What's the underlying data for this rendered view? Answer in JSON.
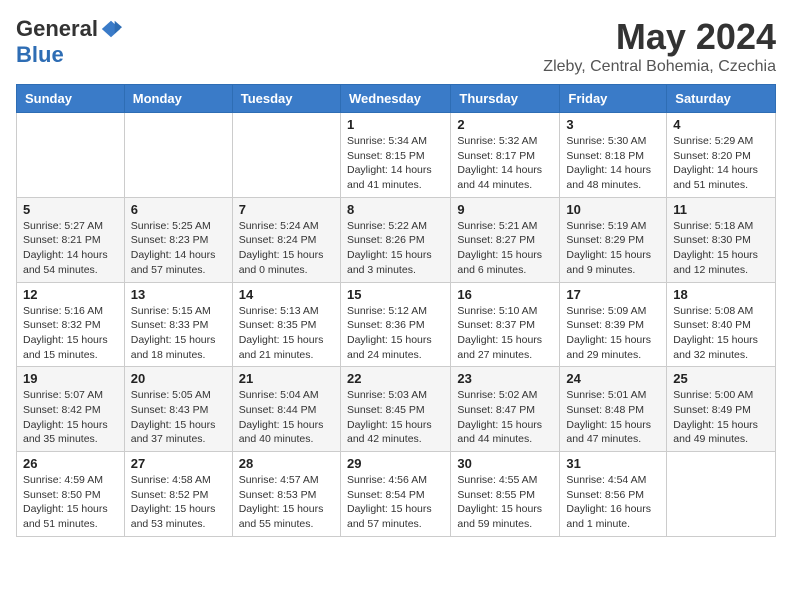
{
  "logo": {
    "general": "General",
    "blue": "Blue"
  },
  "title": "May 2024",
  "subtitle": "Zleby, Central Bohemia, Czechia",
  "days_of_week": [
    "Sunday",
    "Monday",
    "Tuesday",
    "Wednesday",
    "Thursday",
    "Friday",
    "Saturday"
  ],
  "weeks": [
    [
      {
        "day": "",
        "info": ""
      },
      {
        "day": "",
        "info": ""
      },
      {
        "day": "",
        "info": ""
      },
      {
        "day": "1",
        "info": "Sunrise: 5:34 AM\nSunset: 8:15 PM\nDaylight: 14 hours and 41 minutes."
      },
      {
        "day": "2",
        "info": "Sunrise: 5:32 AM\nSunset: 8:17 PM\nDaylight: 14 hours and 44 minutes."
      },
      {
        "day": "3",
        "info": "Sunrise: 5:30 AM\nSunset: 8:18 PM\nDaylight: 14 hours and 48 minutes."
      },
      {
        "day": "4",
        "info": "Sunrise: 5:29 AM\nSunset: 8:20 PM\nDaylight: 14 hours and 51 minutes."
      }
    ],
    [
      {
        "day": "5",
        "info": "Sunrise: 5:27 AM\nSunset: 8:21 PM\nDaylight: 14 hours and 54 minutes."
      },
      {
        "day": "6",
        "info": "Sunrise: 5:25 AM\nSunset: 8:23 PM\nDaylight: 14 hours and 57 minutes."
      },
      {
        "day": "7",
        "info": "Sunrise: 5:24 AM\nSunset: 8:24 PM\nDaylight: 15 hours and 0 minutes."
      },
      {
        "day": "8",
        "info": "Sunrise: 5:22 AM\nSunset: 8:26 PM\nDaylight: 15 hours and 3 minutes."
      },
      {
        "day": "9",
        "info": "Sunrise: 5:21 AM\nSunset: 8:27 PM\nDaylight: 15 hours and 6 minutes."
      },
      {
        "day": "10",
        "info": "Sunrise: 5:19 AM\nSunset: 8:29 PM\nDaylight: 15 hours and 9 minutes."
      },
      {
        "day": "11",
        "info": "Sunrise: 5:18 AM\nSunset: 8:30 PM\nDaylight: 15 hours and 12 minutes."
      }
    ],
    [
      {
        "day": "12",
        "info": "Sunrise: 5:16 AM\nSunset: 8:32 PM\nDaylight: 15 hours and 15 minutes."
      },
      {
        "day": "13",
        "info": "Sunrise: 5:15 AM\nSunset: 8:33 PM\nDaylight: 15 hours and 18 minutes."
      },
      {
        "day": "14",
        "info": "Sunrise: 5:13 AM\nSunset: 8:35 PM\nDaylight: 15 hours and 21 minutes."
      },
      {
        "day": "15",
        "info": "Sunrise: 5:12 AM\nSunset: 8:36 PM\nDaylight: 15 hours and 24 minutes."
      },
      {
        "day": "16",
        "info": "Sunrise: 5:10 AM\nSunset: 8:37 PM\nDaylight: 15 hours and 27 minutes."
      },
      {
        "day": "17",
        "info": "Sunrise: 5:09 AM\nSunset: 8:39 PM\nDaylight: 15 hours and 29 minutes."
      },
      {
        "day": "18",
        "info": "Sunrise: 5:08 AM\nSunset: 8:40 PM\nDaylight: 15 hours and 32 minutes."
      }
    ],
    [
      {
        "day": "19",
        "info": "Sunrise: 5:07 AM\nSunset: 8:42 PM\nDaylight: 15 hours and 35 minutes."
      },
      {
        "day": "20",
        "info": "Sunrise: 5:05 AM\nSunset: 8:43 PM\nDaylight: 15 hours and 37 minutes."
      },
      {
        "day": "21",
        "info": "Sunrise: 5:04 AM\nSunset: 8:44 PM\nDaylight: 15 hours and 40 minutes."
      },
      {
        "day": "22",
        "info": "Sunrise: 5:03 AM\nSunset: 8:45 PM\nDaylight: 15 hours and 42 minutes."
      },
      {
        "day": "23",
        "info": "Sunrise: 5:02 AM\nSunset: 8:47 PM\nDaylight: 15 hours and 44 minutes."
      },
      {
        "day": "24",
        "info": "Sunrise: 5:01 AM\nSunset: 8:48 PM\nDaylight: 15 hours and 47 minutes."
      },
      {
        "day": "25",
        "info": "Sunrise: 5:00 AM\nSunset: 8:49 PM\nDaylight: 15 hours and 49 minutes."
      }
    ],
    [
      {
        "day": "26",
        "info": "Sunrise: 4:59 AM\nSunset: 8:50 PM\nDaylight: 15 hours and 51 minutes."
      },
      {
        "day": "27",
        "info": "Sunrise: 4:58 AM\nSunset: 8:52 PM\nDaylight: 15 hours and 53 minutes."
      },
      {
        "day": "28",
        "info": "Sunrise: 4:57 AM\nSunset: 8:53 PM\nDaylight: 15 hours and 55 minutes."
      },
      {
        "day": "29",
        "info": "Sunrise: 4:56 AM\nSunset: 8:54 PM\nDaylight: 15 hours and 57 minutes."
      },
      {
        "day": "30",
        "info": "Sunrise: 4:55 AM\nSunset: 8:55 PM\nDaylight: 15 hours and 59 minutes."
      },
      {
        "day": "31",
        "info": "Sunrise: 4:54 AM\nSunset: 8:56 PM\nDaylight: 16 hours and 1 minute."
      },
      {
        "day": "",
        "info": ""
      }
    ]
  ]
}
